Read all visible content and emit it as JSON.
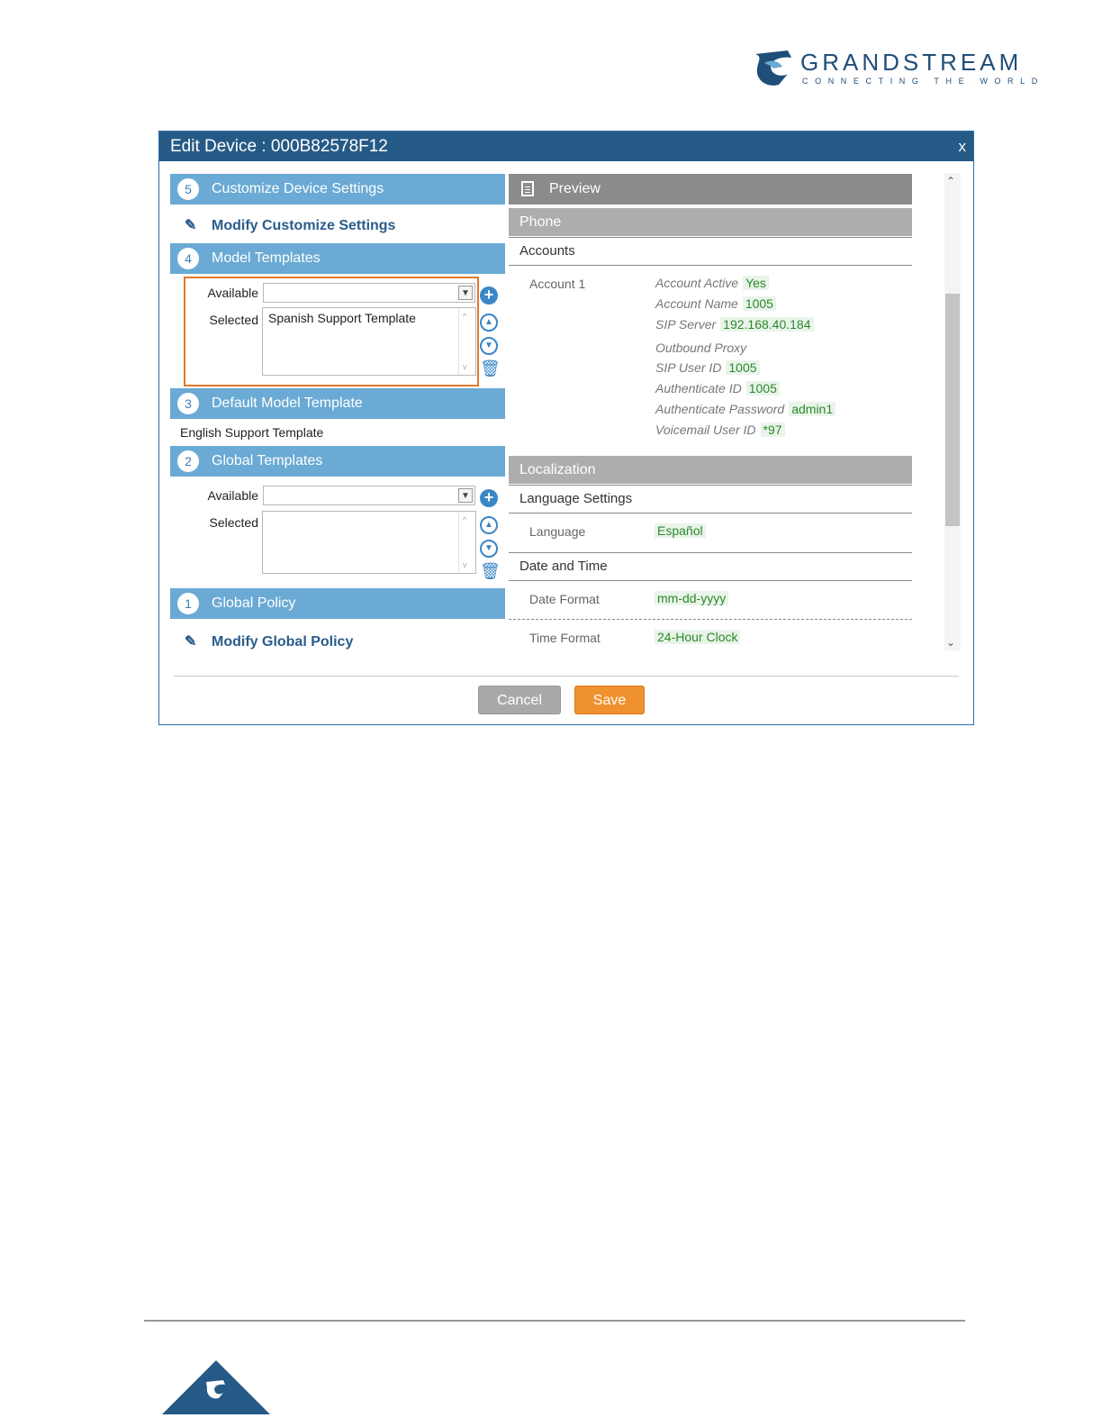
{
  "brand": {
    "name": "GRANDSTREAM",
    "tagline": "CONNECTING THE WORLD",
    "color": "#1f4e79"
  },
  "dialog": {
    "title": "Edit Device : 000B82578F12",
    "close_label": "x",
    "title_bar_color": "#265a86"
  },
  "left": {
    "customize": {
      "number": "5",
      "label": "Customize Device Settings",
      "action": "Modify Customize Settings"
    },
    "model_templates": {
      "number": "4",
      "label": "Model Templates",
      "available_label": "Available",
      "available_value": "",
      "selected_label": "Selected",
      "selected_items": [
        "Spanish Support Template"
      ]
    },
    "default_model_template": {
      "number": "3",
      "label": "Default Model Template",
      "value": "English Support Template"
    },
    "global_templates": {
      "number": "2",
      "label": "Global Templates",
      "available_label": "Available",
      "available_value": "",
      "selected_label": "Selected",
      "selected_items": []
    },
    "global_policy": {
      "number": "1",
      "label": "Global Policy",
      "action": "Modify Global Policy"
    },
    "section_color": "#6aaad4",
    "highlight_color": "#e07a2c"
  },
  "preview": {
    "header": "Preview",
    "phone": {
      "label": "Phone",
      "accounts_label": "Accounts",
      "account_name": "Account 1",
      "fields": [
        {
          "key": "Account Active",
          "value": "Yes"
        },
        {
          "key": "Account Name",
          "value": "1005"
        },
        {
          "key": "SIP Server",
          "value": "192.168.40.184"
        },
        {
          "key": "Outbound Proxy",
          "value": ""
        },
        {
          "key": "SIP User ID",
          "value": "1005"
        },
        {
          "key": "Authenticate ID",
          "value": "1005"
        },
        {
          "key": "Authenticate Password",
          "value": "admin1"
        },
        {
          "key": "Voicemail User ID",
          "value": "*97"
        }
      ]
    },
    "localization": {
      "label": "Localization",
      "language_settings_label": "Language Settings",
      "language_key": "Language",
      "language_value": "Español",
      "date_time_label": "Date and Time",
      "date_format_key": "Date Format",
      "date_format_value": "mm-dd-yyyy",
      "time_format_key": "Time Format",
      "time_format_value": "24-Hour Clock"
    },
    "value_color": "#2a8a2a"
  },
  "footer": {
    "cancel_label": "Cancel",
    "save_label": "Save",
    "save_color": "#f0912f"
  }
}
